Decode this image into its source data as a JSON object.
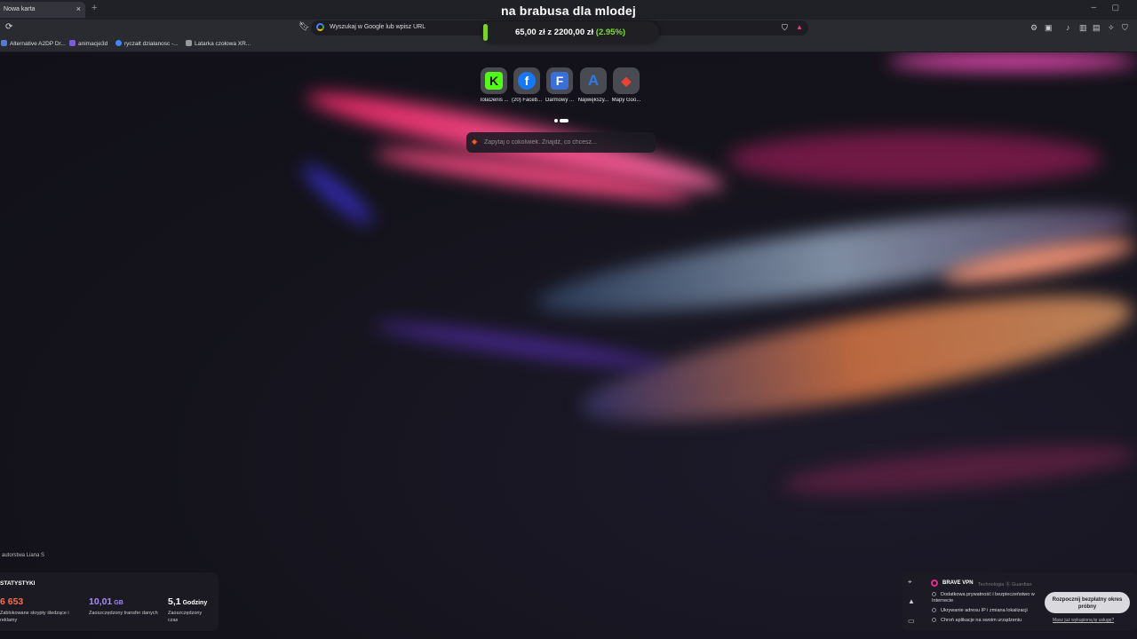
{
  "tab": {
    "title": "Nowa karta",
    "close": "×",
    "new_tab": "+"
  },
  "window": {
    "minimize": "–",
    "maximize": "▢"
  },
  "overlay_title": "na brabusa dla mlodej",
  "price_tracker": {
    "current": "65,00 zł",
    "separator": "z",
    "goal": "2200,00 zł",
    "percent": "(2.95%)",
    "progress_fraction": 0.0295,
    "bar_color": "#7ecf2e"
  },
  "toolbar": {
    "url_placeholder": "Wyszukaj w Google lub wpisz URL",
    "reload_icon": "reload-icon",
    "bookmark_icon": "bookmark-icon"
  },
  "bookmarks": [
    {
      "label": "Alternative A2DP Dr...",
      "icon_color": "#4f7bd8"
    },
    {
      "label": "animacje3d",
      "icon_color": "#7b5bd6"
    },
    {
      "label": "ryczałt działanosc -...",
      "icon_color": "#4285f4"
    },
    {
      "label": "Latarka czołowa XR...",
      "icon_color": "#999999"
    }
  ],
  "top_sites": [
    {
      "label": "TolaDenis ...",
      "glyph": "K",
      "fg": "#111",
      "bg": "#53fc18"
    },
    {
      "label": "(20) Faceb...",
      "glyph": "f",
      "fg": "#fff",
      "bg": "#1877f2"
    },
    {
      "label": "Darmowy ...",
      "glyph": "F",
      "fg": "#fff",
      "bg": "#3a6fd8"
    },
    {
      "label": "Największy...",
      "glyph": "A",
      "fg": "#2c7be5",
      "bg": "transparent"
    },
    {
      "label": "Mapy Goo...",
      "glyph": "◆",
      "fg": "#ea4335",
      "bg": "transparent"
    }
  ],
  "search": {
    "placeholder": "Zapytaj o cokolwiek. Znajdź, co chcesz..."
  },
  "photo_credit": "autorstwa Liana S",
  "stats": {
    "title": "STATYSTYKI",
    "items": [
      {
        "value": "6 653",
        "unit": "",
        "desc": "Zablokowane skrypty śledzące i reklamy",
        "color": "#ff6a4d"
      },
      {
        "value": "10,01",
        "unit": "GB",
        "desc": "Zaoszczędzony transfer danych",
        "color": "#a88cff"
      },
      {
        "value": "5,1",
        "unit": "Godziny",
        "desc": "Zaoszczędzony czas",
        "color": "#ffffff"
      }
    ]
  },
  "vpn": {
    "title": "BRAVE VPN",
    "tech": "Technologia ⓖ Guardian",
    "features": [
      "Dodatkowa prywatność i bezpieczeństwo w Internecie",
      "Ukrywanie adresu IP i zmiana lokalizacji",
      "Chroń aplikacje na swoim urządzeniu"
    ],
    "cta": "Rozpocznij bezpłatny okres próbny",
    "link": "Masz już wykupioną tę usługę?"
  }
}
